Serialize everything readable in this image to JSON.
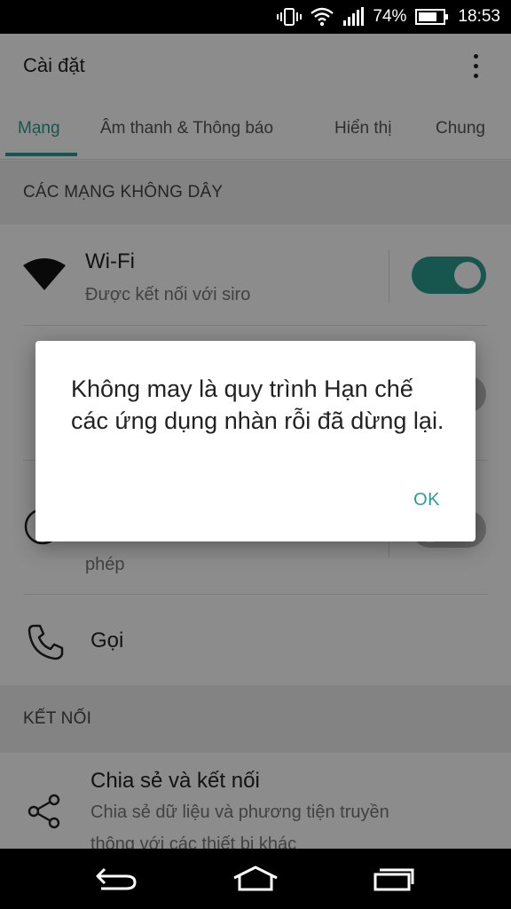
{
  "status_bar": {
    "battery_percent": "74%",
    "time": "18:53",
    "icons": [
      "vibrate-icon",
      "wifi-icon",
      "signal-icon",
      "battery-icon"
    ]
  },
  "app_bar": {
    "title": "Cài đặt",
    "menu_icon": "overflow-menu-icon"
  },
  "tabs": [
    {
      "label": "Mạng",
      "active": true
    },
    {
      "label": "Âm thanh & Thông báo",
      "active": false
    },
    {
      "label": "Hiển thị",
      "active": false
    },
    {
      "label": "Chung",
      "active": false
    }
  ],
  "sections": {
    "wireless": {
      "header": "CÁC MẠNG KHÔNG DÂY",
      "wifi": {
        "title": "Wi-Fi",
        "subtitle": "Được kết nối với siro",
        "icon": "wifi-icon",
        "enabled": true
      },
      "hidden_row_tail": "phép",
      "call": {
        "title": "Gọi",
        "icon": "phone-icon"
      }
    },
    "connections": {
      "header": "KẾT NỐI",
      "share": {
        "title": "Chia sẻ và kết nối",
        "subtitle_line1": "Chia sẻ dữ liệu và phương tiện truyền",
        "subtitle_line2": "thông với các thiết bị khác",
        "icon": "share-icon"
      }
    }
  },
  "dialog": {
    "message": "Không may là quy trình Hạn chế các ứng dụng nhàn rỗi đã dừng lại.",
    "ok_label": "OK"
  },
  "colors": {
    "accent": "#2a9d8f",
    "status_bar": "#000000",
    "section_bg": "#eeeeee"
  }
}
